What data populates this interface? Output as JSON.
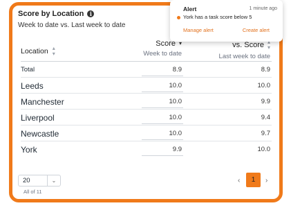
{
  "header": {
    "title": "Score by Location",
    "info_icon": "i",
    "subtitle": "Week to date vs. Last week to date"
  },
  "table": {
    "columns": {
      "location": "Location",
      "score": "Score",
      "score_sub": "Week to date",
      "vs_score": "vs. Score",
      "vs_score_sub": "Last week to date"
    },
    "rows": [
      {
        "name": "Total",
        "score": "8.9",
        "vs": "8.9"
      },
      {
        "name": "Leeds",
        "score": "10.0",
        "vs": "10.0"
      },
      {
        "name": "Manchester",
        "score": "10.0",
        "vs": "9.9"
      },
      {
        "name": "Liverpool",
        "score": "10.0",
        "vs": "9.4"
      },
      {
        "name": "Newcastle",
        "score": "10.0",
        "vs": "9.7"
      },
      {
        "name": "York",
        "score": "9.9",
        "vs": "10.0"
      }
    ]
  },
  "pagination": {
    "page_size": "20",
    "count_label": "All of 11",
    "current_page": "1",
    "prev_label": "‹",
    "next_label": "›"
  },
  "alert": {
    "title": "Alert",
    "time": "1 minute ago",
    "message": "York has a task score below 5",
    "manage_label": "Manage alert",
    "create_label": "Create alert"
  },
  "colors": {
    "accent": "#f07a1a",
    "link": "#e2701c"
  }
}
